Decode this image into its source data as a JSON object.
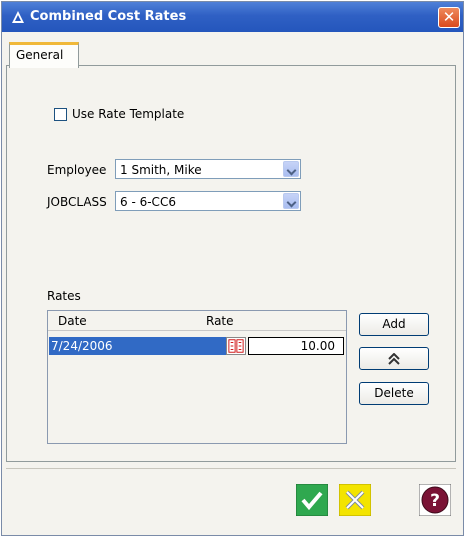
{
  "window": {
    "title": "Combined Cost Rates",
    "close_label": "✕"
  },
  "tabs": [
    {
      "label": "General"
    }
  ],
  "use_rate_template": {
    "label": "Use Rate Template",
    "checked": false
  },
  "employee": {
    "label": "Employee",
    "value": "1 Smith, Mike"
  },
  "jobclass": {
    "label": "JOBCLASS",
    "value": "6 - 6-CC6"
  },
  "rates": {
    "label": "Rates",
    "columns": [
      "Date",
      "Rate"
    ],
    "rows": [
      {
        "date": "7/24/2006",
        "rate": "10.00"
      }
    ]
  },
  "buttons": {
    "add": "Add",
    "delete": "Delete"
  },
  "icons": {
    "title": "app-triangle-icon",
    "up": "chevron-double-up-icon",
    "ok": "check-icon",
    "cancel": "x-icon",
    "help": "question-icon"
  },
  "colors": {
    "titlebar": "#2f60c4",
    "selection": "#316ac5",
    "ok": "#2fa84f",
    "cancel": "#f3e400",
    "help": "#7a1235"
  }
}
